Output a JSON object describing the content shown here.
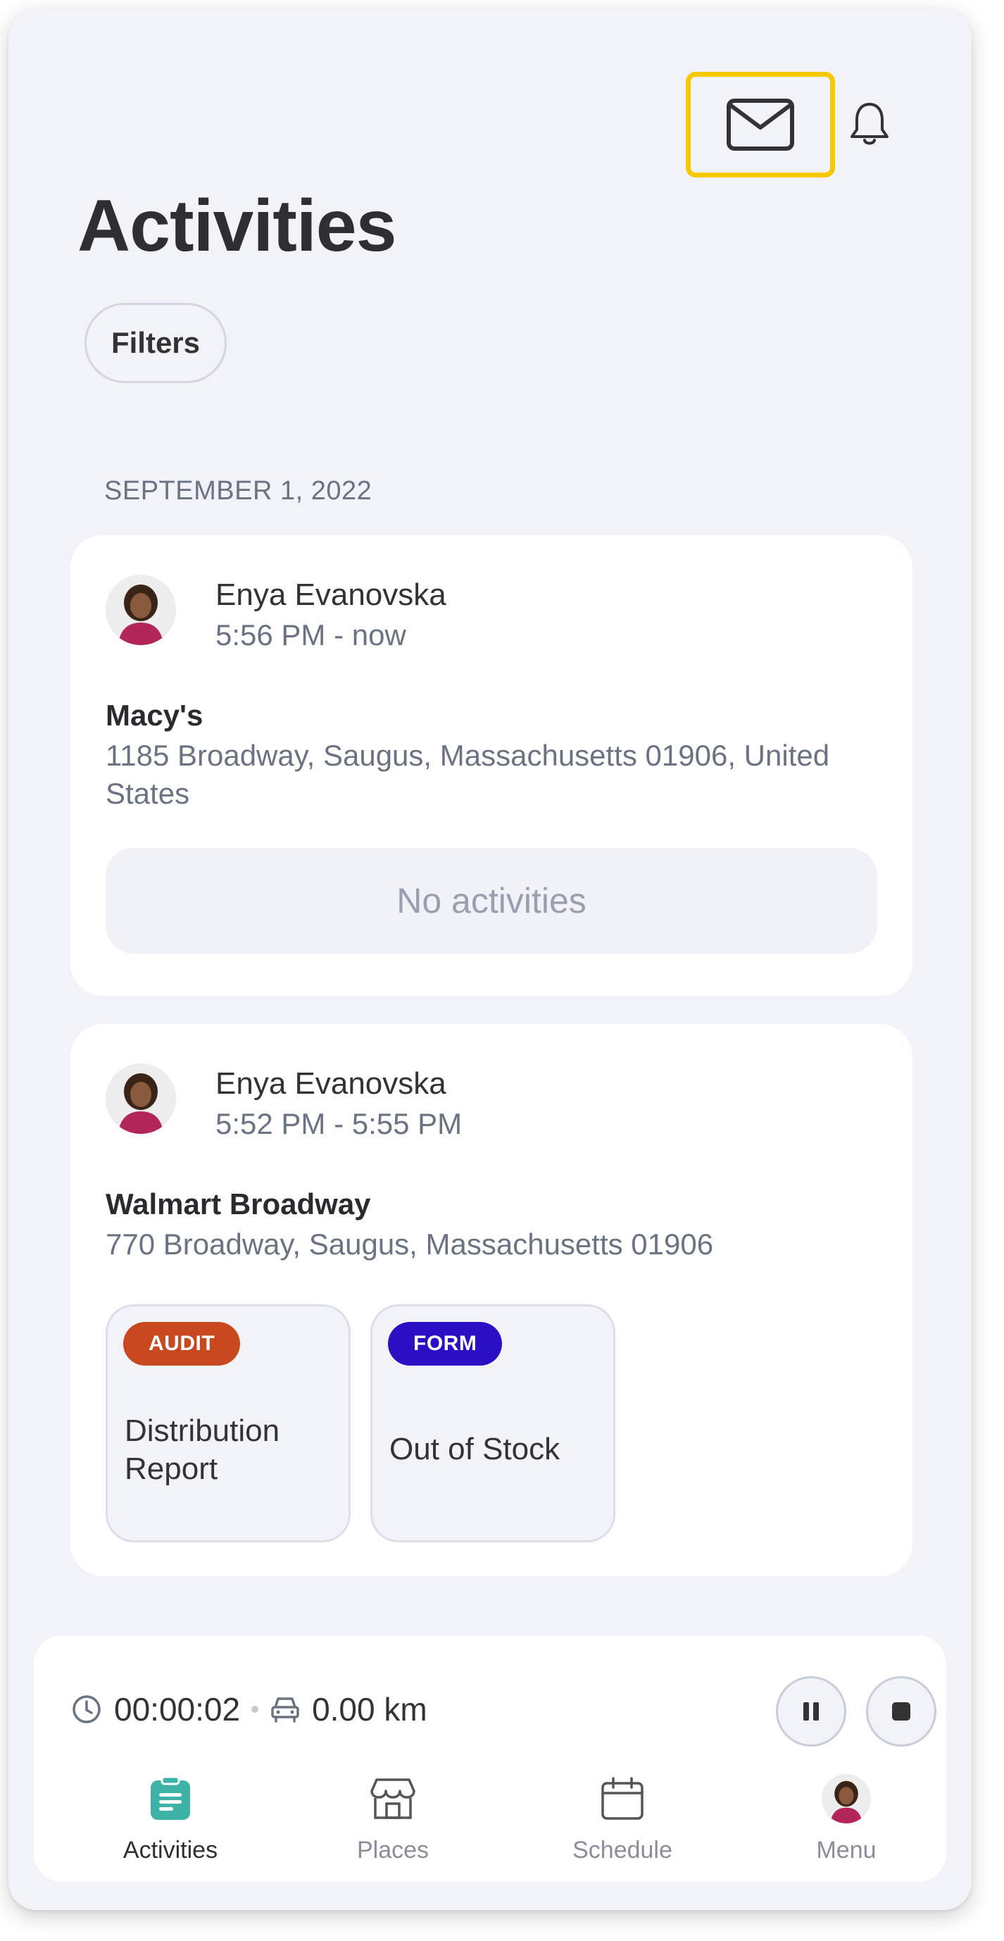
{
  "header": {
    "title": "Activities",
    "filters_label": "Filters",
    "mail_icon": "mail-icon",
    "bell_icon": "bell-icon"
  },
  "date_group": "SEPTEMBER 1, 2022",
  "visits": [
    {
      "user": "Enya Evanovska",
      "time": "5:56 PM - now",
      "place": "Macy's",
      "address": "1185 Broadway, Saugus, Massachusetts 01906, United States",
      "empty_text": "No activities"
    },
    {
      "user": "Enya Evanovska",
      "time": "5:52 PM - 5:55 PM",
      "place": "Walmart Broadway",
      "address": "770 Broadway, Saugus, Massachusetts 01906",
      "tasks": [
        {
          "badge": "AUDIT",
          "badge_color": "#c8491f",
          "title": "Distribution Report"
        },
        {
          "badge": "FORM",
          "badge_color": "#2a0fc4",
          "title": "Out of Stock"
        }
      ]
    }
  ],
  "tracker": {
    "timer": "00:00:02",
    "distance": "0.00 km",
    "pause_icon": "pause-icon",
    "stop_icon": "stop-icon"
  },
  "tabs": [
    {
      "label": "Activities",
      "icon": "clipboard-icon",
      "active": true,
      "color": "#3fb2a7"
    },
    {
      "label": "Places",
      "icon": "store-icon",
      "active": false
    },
    {
      "label": "Schedule",
      "icon": "calendar-icon",
      "active": false
    },
    {
      "label": "Menu",
      "icon": "avatar",
      "active": false
    }
  ],
  "colors": {
    "background": "#f2f3f9",
    "highlight": "#f5c800",
    "accent": "#3fb2a7"
  }
}
